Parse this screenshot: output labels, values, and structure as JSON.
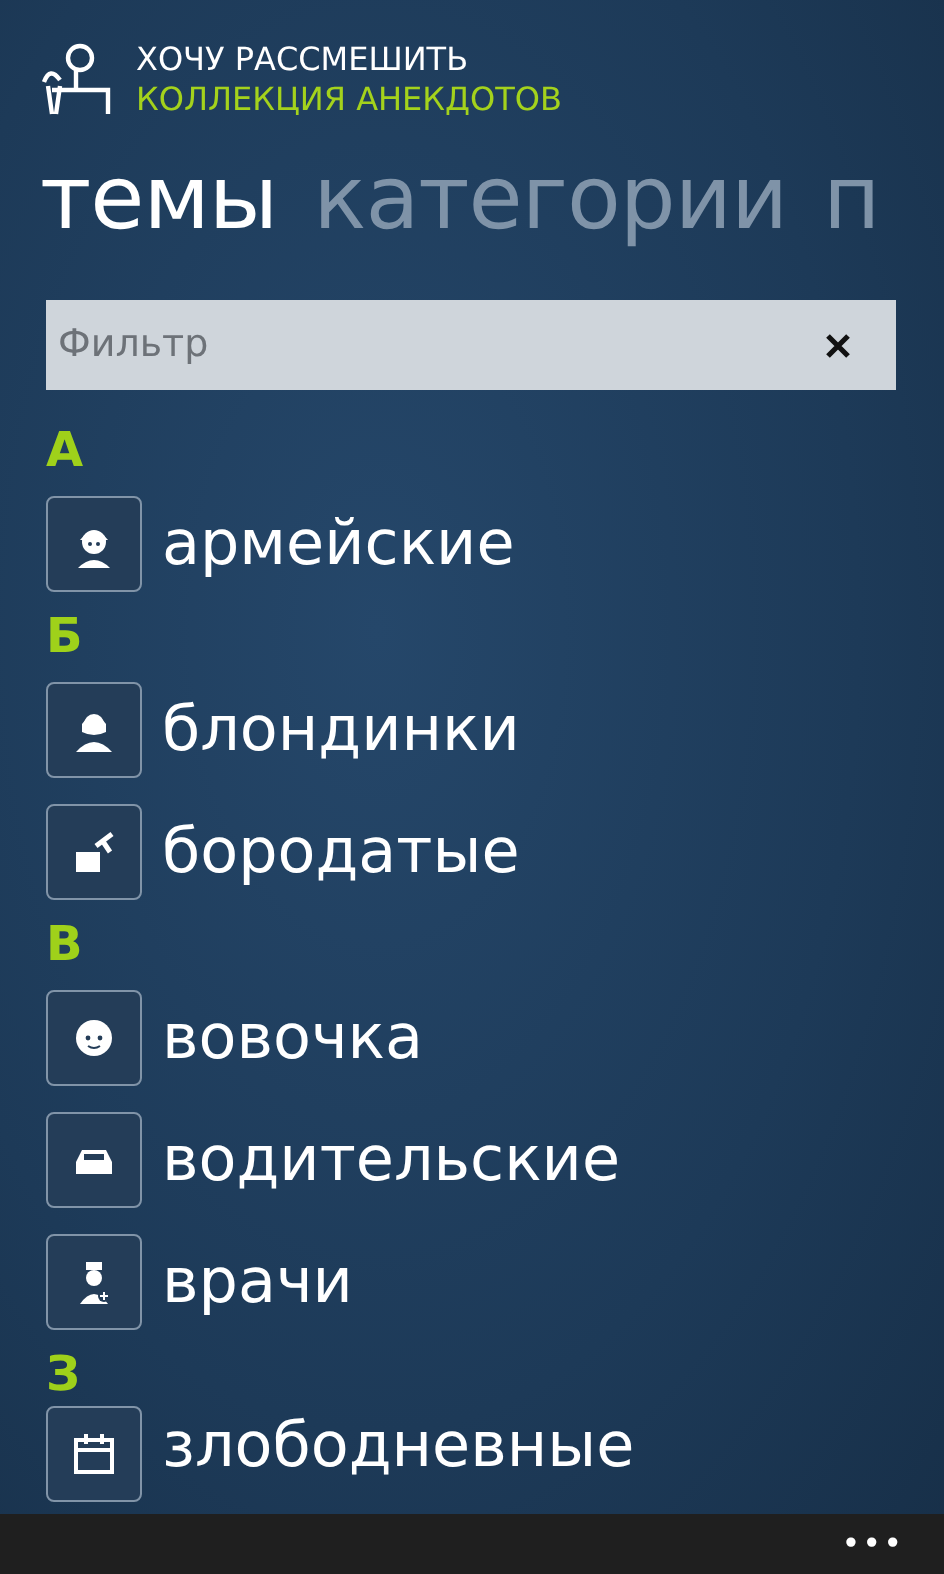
{
  "app": {
    "title": "ХОЧУ РАССМЕШИТЬ",
    "subtitle": "КОЛЛЕКЦИЯ АНЕКДОТОВ"
  },
  "pivot": [
    {
      "label": "темы",
      "selected": true
    },
    {
      "label": "категории",
      "selected": false
    },
    {
      "label": "п",
      "selected": false
    }
  ],
  "filter": {
    "placeholder": "Фильтр"
  },
  "groups": [
    {
      "letter": "А",
      "items": [
        {
          "label": "армейские"
        }
      ]
    },
    {
      "letter": "Б",
      "items": [
        {
          "label": "блондинки"
        },
        {
          "label": "бородатые"
        }
      ]
    },
    {
      "letter": "В",
      "items": [
        {
          "label": "вовочка"
        },
        {
          "label": "водительские"
        },
        {
          "label": "врачи"
        }
      ]
    },
    {
      "letter": "З",
      "items": [
        {
          "label": "злободневные"
        }
      ]
    }
  ],
  "app_bar": {
    "more": "•••"
  }
}
